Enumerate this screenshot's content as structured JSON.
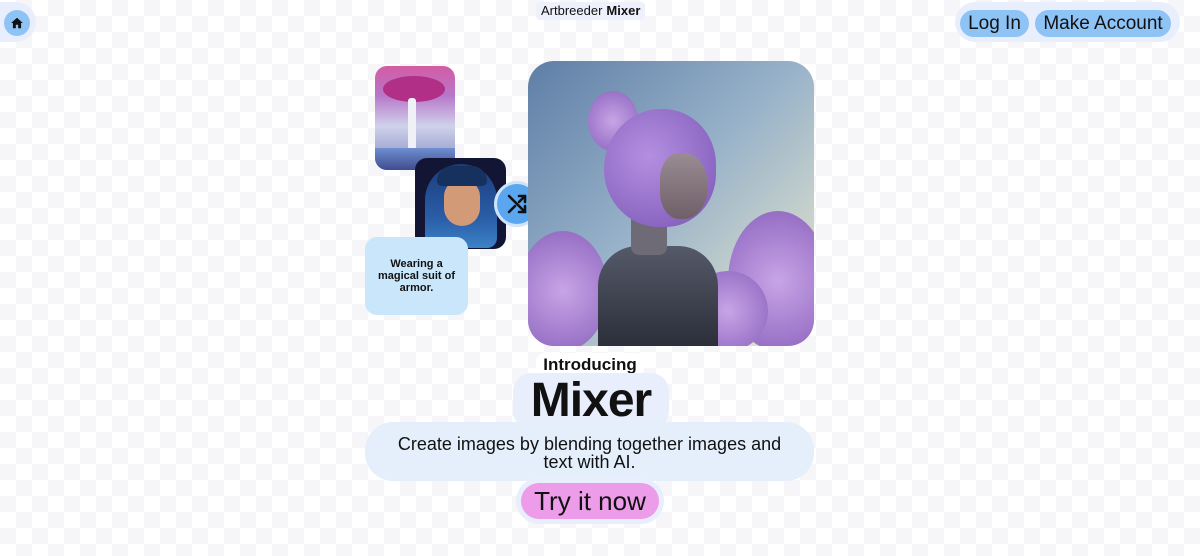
{
  "header": {
    "brand": "Artbreeder",
    "product": "Mixer",
    "login_label": "Log In",
    "make_account_label": "Make Account"
  },
  "mixer_demo": {
    "prompt_text": "Wearing a magical suit of armor."
  },
  "hero": {
    "eyebrow": "Introducing",
    "title": "Mixer",
    "description": "Create images by blending together images and text with AI.",
    "cta_label": "Try it now"
  },
  "icons": {
    "home": "home-icon",
    "mix": "shuffle-icon"
  },
  "colors": {
    "accent_blue": "#8ec3f5",
    "accent_pink": "#ec9ce9",
    "panel_bg": "#e8eefc"
  }
}
